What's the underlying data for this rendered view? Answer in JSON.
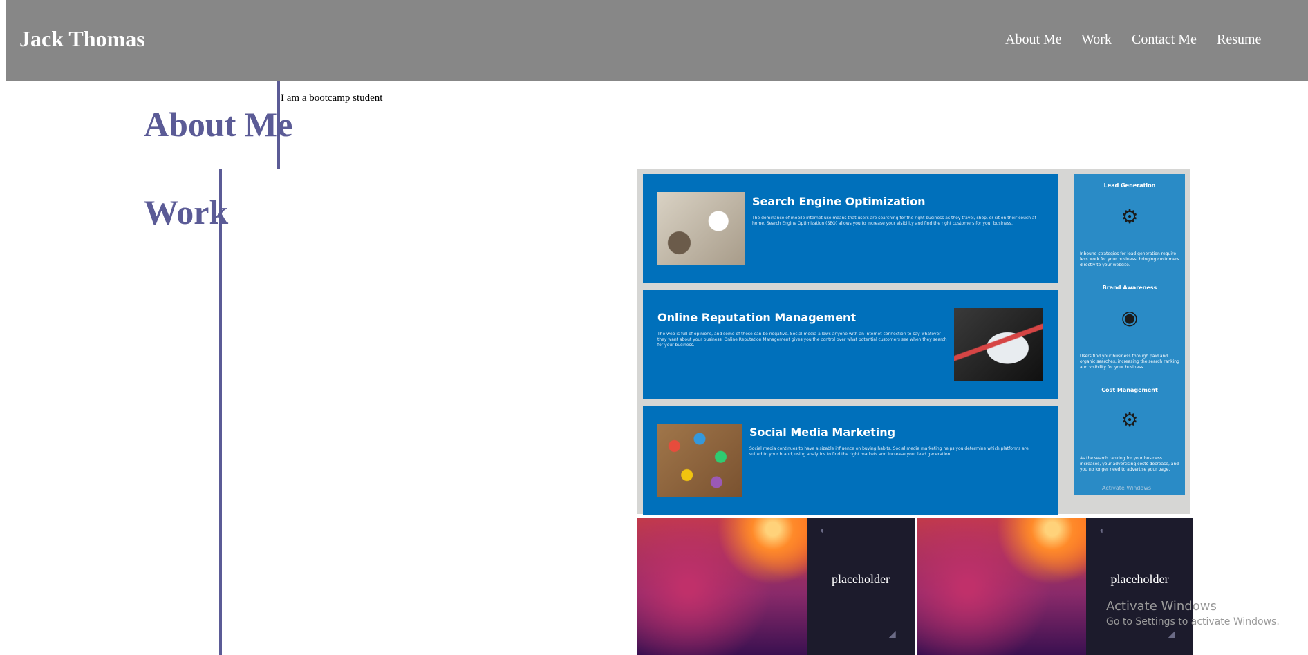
{
  "header": {
    "brand": "Jack Thomas",
    "nav": [
      "About Me",
      "Work",
      "Contact Me",
      "Resume"
    ]
  },
  "about": {
    "title": "About Me",
    "text": "I am a bootcamp student"
  },
  "work": {
    "title": "Work",
    "marketing_panel": {
      "cards": [
        {
          "title": "Search Engine Optimization",
          "text": "The dominance of mobile internet use means that users are searching for the right business as they travel, shop, or sit on their couch at home. Search Engine Optimization (SEO) allows you to increase your visibility and find the right customers for your business.",
          "image_icon": "seo-desk-photo"
        },
        {
          "title": "Online Reputation Management",
          "text": "The web is full of opinions, and some of these can be negative. Social media allows anyone with an internet connection to say whatever they want about your business. Online Reputation Management gives you the control over what potential customers see when they search for your business.",
          "image_icon": "reputation-laptop-photo"
        },
        {
          "title": "Social Media Marketing",
          "text": "Social media continues to have a sizable influence on buying habits. Social media marketing helps you determine which platforms are suited to your brand, using analytics to find the right markets and increase your lead generation.",
          "image_icon": "social-media-icons-photo"
        }
      ],
      "sidebar": [
        {
          "title": "Lead Generation",
          "icon": "lightbulb-gear-icon",
          "text": "Inbound strategies for lead generation require less work for your business, bringing customers directly to your website."
        },
        {
          "title": "Brand Awareness",
          "icon": "broadcast-person-icon",
          "text": "Users find your business through paid and organic searches, increasing the search ranking and visibility for your business."
        },
        {
          "title": "Cost Management",
          "icon": "money-gears-icon",
          "text": "As the search ranking for your business increases, your advertising costs decrease, and you no longer need to advertise your page."
        }
      ],
      "watermark": "Activate Windows"
    },
    "placeholders": [
      {
        "label": "placeholder"
      },
      {
        "label": "placeholder"
      }
    ]
  },
  "os_watermark": {
    "line1": "Activate Windows",
    "line2": "Go to Settings to activate Windows."
  },
  "colors": {
    "header_bg": "#878787",
    "accent": "#5b5b96",
    "card_blue": "#0070bb",
    "sidebar_blue": "#2a8bc6"
  }
}
